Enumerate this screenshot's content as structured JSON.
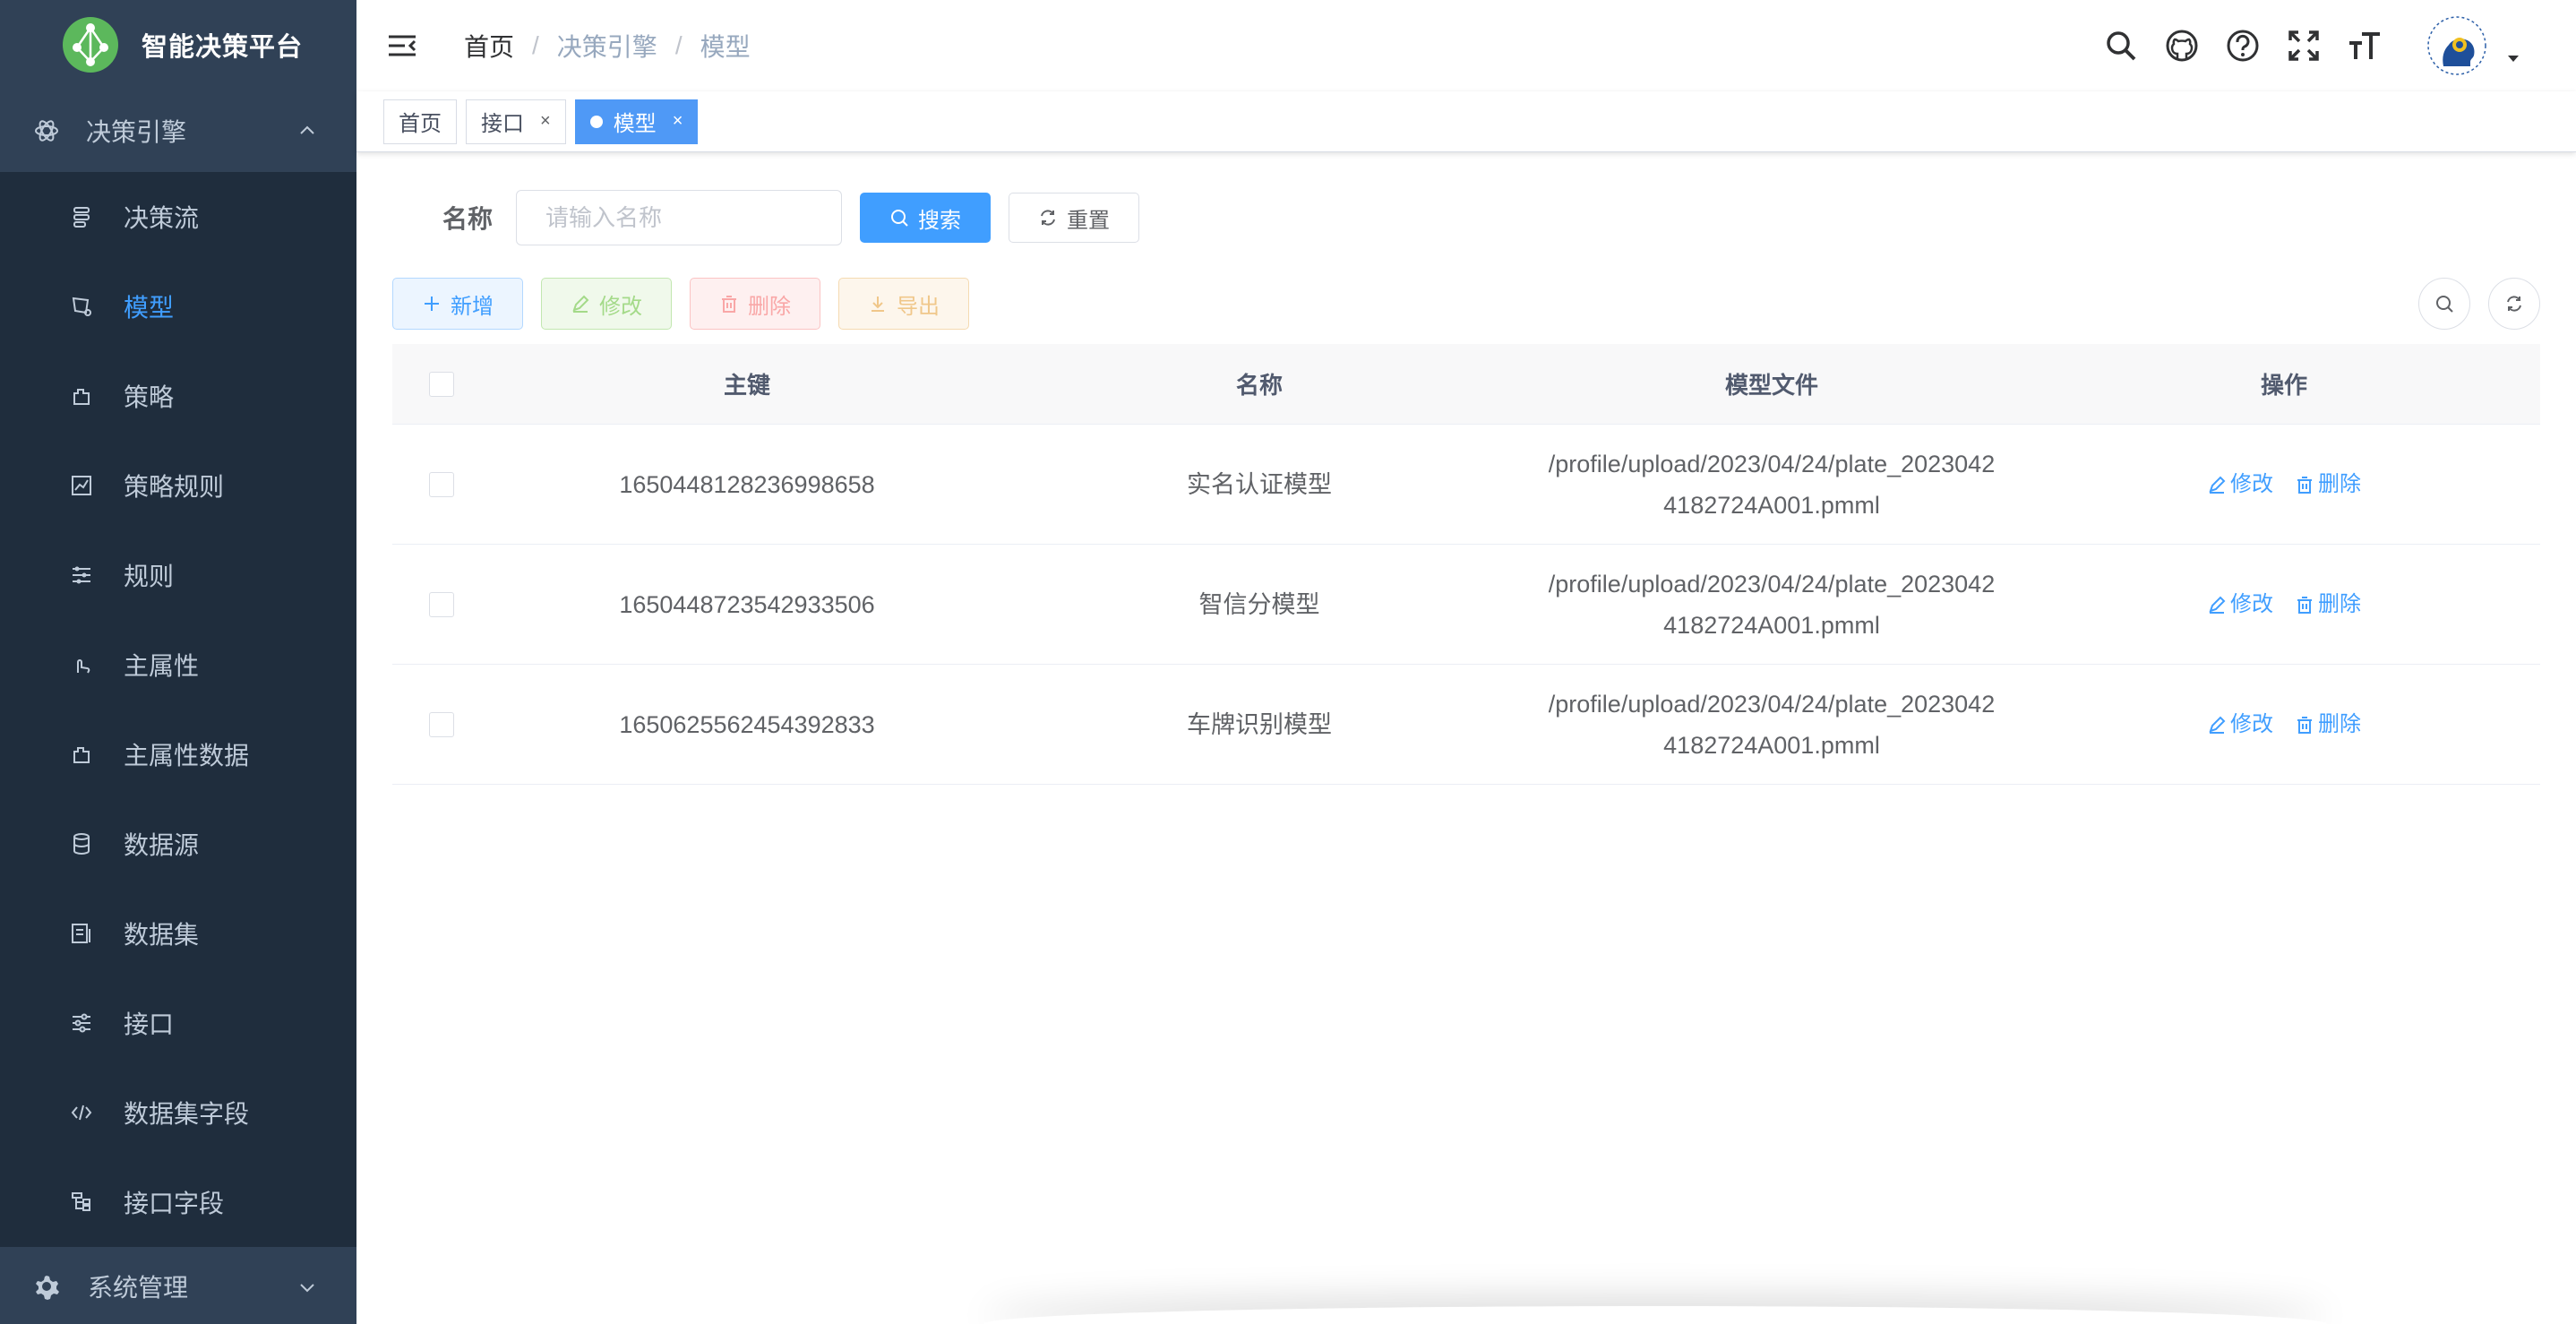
{
  "app": {
    "title": "智能决策平台"
  },
  "sidebar": {
    "group": {
      "label": "决策引擎",
      "icon": "engine-icon"
    },
    "items": [
      {
        "label": "决策流",
        "icon": "flow-icon",
        "active": false
      },
      {
        "label": "模型",
        "icon": "model-icon",
        "active": true
      },
      {
        "label": "策略",
        "icon": "strategy-icon",
        "active": false
      },
      {
        "label": "策略规则",
        "icon": "strategy-rule-icon",
        "active": false
      },
      {
        "label": "规则",
        "icon": "rule-icon",
        "active": false
      },
      {
        "label": "主属性",
        "icon": "attribute-icon",
        "active": false
      },
      {
        "label": "主属性数据",
        "icon": "attribute-data-icon",
        "active": false
      },
      {
        "label": "数据源",
        "icon": "database-icon",
        "active": false
      },
      {
        "label": "数据集",
        "icon": "dataset-icon",
        "active": false
      },
      {
        "label": "接口",
        "icon": "api-icon",
        "active": false
      },
      {
        "label": "数据集字段",
        "icon": "code-icon",
        "active": false
      },
      {
        "label": "接口字段",
        "icon": "tree-icon",
        "active": false
      }
    ],
    "system": {
      "label": "系统管理",
      "icon": "gear-icon"
    }
  },
  "breadcrumb": [
    "首页",
    "决策引擎",
    "模型"
  ],
  "tags": [
    {
      "label": "首页",
      "closable": false,
      "active": false
    },
    {
      "label": "接口",
      "closable": true,
      "active": false
    },
    {
      "label": "模型",
      "closable": true,
      "active": true
    }
  ],
  "search": {
    "label": "名称",
    "placeholder": "请输入名称",
    "search_btn": "搜索",
    "reset_btn": "重置"
  },
  "toolbar": {
    "add": "新增",
    "edit": "修改",
    "delete": "删除",
    "export": "导出"
  },
  "table": {
    "columns": [
      "主键",
      "名称",
      "模型文件",
      "操作"
    ],
    "rows": [
      {
        "id": "1650448128236998658",
        "name": "实名认证模型",
        "file_line1": "/profile/upload/2023/04/24/plate_2023042",
        "file_line2": "4182724A001.pmml"
      },
      {
        "id": "1650448723542933506",
        "name": "智信分模型",
        "file_line1": "/profile/upload/2023/04/24/plate_2023042",
        "file_line2": "4182724A001.pmml"
      },
      {
        "id": "1650625562454392833",
        "name": "车牌识别模型",
        "file_line1": "/profile/upload/2023/04/24/plate_2023042",
        "file_line2": "4182724A001.pmml"
      }
    ],
    "op_edit": "修改",
    "op_delete": "删除"
  },
  "colors": {
    "sidebar_bg": "#304156",
    "submenu_bg": "#1f2d3d",
    "primary": "#409eff",
    "logo_green": "#4caf50"
  }
}
